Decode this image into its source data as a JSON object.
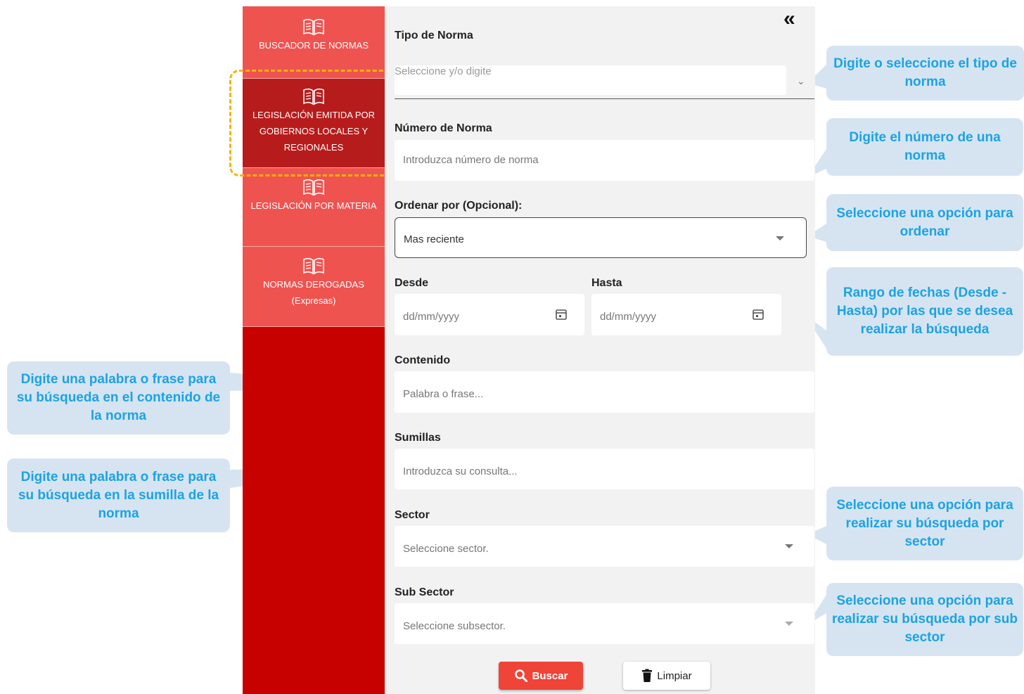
{
  "sidebar": {
    "items": [
      {
        "label": "BUSCADOR DE NORMAS",
        "active": false,
        "icon": "open-book-icon"
      },
      {
        "label": "LEGISLACIÓN EMITIDA POR GOBIERNOS LOCALES Y REGIONALES",
        "active": true,
        "icon": "open-book-icon"
      },
      {
        "label": "LEGISLACIÓN POR MATERIA",
        "active": false,
        "icon": "open-book-icon"
      },
      {
        "label": "NORMAS DEROGADAS (Expresas)",
        "active": false,
        "icon": "open-book-icon"
      }
    ]
  },
  "form": {
    "collapse_icon": "«",
    "tipo_norma": {
      "label": "Tipo de Norma",
      "placeholder": "Seleccione y/o digite"
    },
    "numero_norma": {
      "label": "Número de Norma",
      "placeholder": "Introduzca número de norma"
    },
    "ordenar": {
      "label": "Ordenar por (Opcional):",
      "value": "Mas reciente"
    },
    "desde": {
      "label": "Desde",
      "placeholder": "dd/mm/yyyy"
    },
    "hasta": {
      "label": "Hasta",
      "placeholder": "dd/mm/yyyy"
    },
    "contenido": {
      "label": "Contenido",
      "placeholder": "Palabra o frase..."
    },
    "sumillas": {
      "label": "Sumillas",
      "placeholder": "Introduzca su consulta..."
    },
    "sector": {
      "label": "Sector",
      "placeholder": "Seleccione sector."
    },
    "sub_sector": {
      "label": "Sub Sector",
      "placeholder": "Seleccione subsector."
    },
    "buscar_label": "Buscar",
    "limpiar_label": "Limpiar"
  },
  "callouts": {
    "tipo": "Digite o seleccione el tipo de norma",
    "numero": "Digite el número de una norma",
    "ordenar": "Seleccione una opción para ordenar",
    "fechas": "Rango de fechas (Desde - Hasta) por las que se desea realizar la búsqueda",
    "contenido": "Digite una palabra o frase para su búsqueda en el contenido de la norma",
    "sumilla": "Digite una palabra o frase para su búsqueda en la sumilla de la norma",
    "sector": "Seleccione una opción para realizar su búsqueda por sector",
    "sub_sector": "Seleccione una opción para realizar su búsqueda por sub sector"
  },
  "colors": {
    "sidebar_dark": "#c70000",
    "sidebar_item": "#ef5350",
    "sidebar_active": "#b71c1c",
    "highlight": "#f6b400",
    "callout_bg": "#d6e4f2",
    "callout_text": "#1ba3e3",
    "buscar_button": "#ef4438"
  }
}
